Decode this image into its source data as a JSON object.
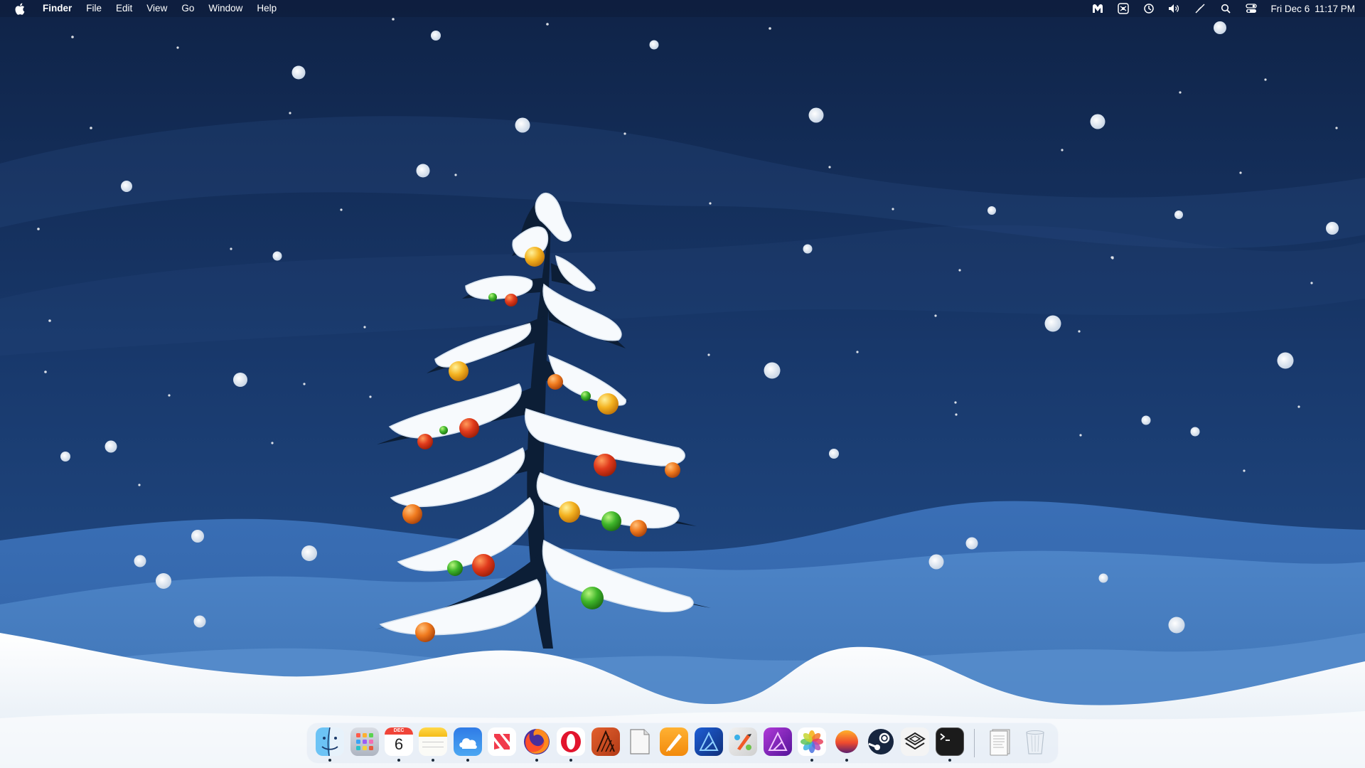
{
  "menubar": {
    "app_name": "Finder",
    "menus": [
      "File",
      "Edit",
      "View",
      "Go",
      "Window",
      "Help"
    ],
    "clock": {
      "date": "Fri Dec 6",
      "time": "11:17 PM"
    },
    "status_icons": [
      "malwarebytes-icon",
      "keyboard-icon",
      "time-machine-icon",
      "volume-icon",
      "wifi-off-icon",
      "spotlight-search-icon",
      "control-center-icon"
    ]
  },
  "dock": {
    "calendar": {
      "month": "DEC",
      "day": "6"
    },
    "apps": [
      {
        "name": "finder",
        "running": true
      },
      {
        "name": "launchpad",
        "running": false
      },
      {
        "name": "calendar",
        "running": true
      },
      {
        "name": "notes",
        "running": true
      },
      {
        "name": "weather",
        "running": true
      },
      {
        "name": "news",
        "running": false
      },
      {
        "name": "firefox",
        "running": true
      },
      {
        "name": "opera",
        "running": true
      },
      {
        "name": "affinity-publisher-alt",
        "running": false
      },
      {
        "name": "textedit",
        "running": false
      },
      {
        "name": "pages",
        "running": false
      },
      {
        "name": "affinity-designer",
        "running": false
      },
      {
        "name": "pixelmator",
        "running": false
      },
      {
        "name": "affinity-photo",
        "running": false
      },
      {
        "name": "photos",
        "running": true
      },
      {
        "name": "sphere-app",
        "running": true
      },
      {
        "name": "steam",
        "running": false
      },
      {
        "name": "parallels",
        "running": false
      },
      {
        "name": "terminal",
        "running": true
      }
    ],
    "trailing": [
      {
        "name": "document-stack",
        "running": false
      },
      {
        "name": "trash",
        "running": false
      }
    ]
  },
  "colors": {
    "sky_top": "#0f2347",
    "sky_bottom": "#24518e",
    "hill_blue": "#3b72b8",
    "snow": "#f3f7fb",
    "ornament_red": "#e03a1c",
    "ornament_gold": "#f4b321",
    "ornament_green": "#3fb62a"
  }
}
